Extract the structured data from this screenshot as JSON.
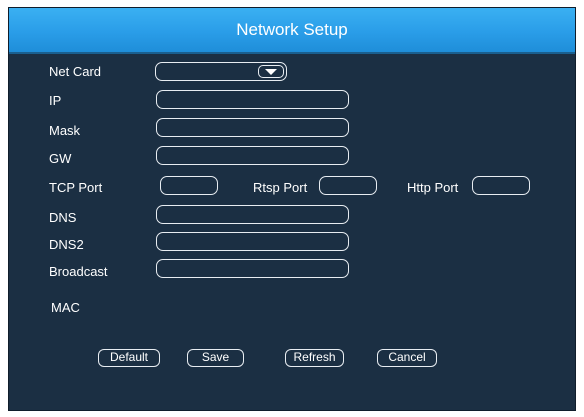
{
  "dialog": {
    "title": "Network Setup"
  },
  "form": {
    "net_card_label": "Net Card",
    "net_card_value": "",
    "ip_label": "IP",
    "ip_value": "",
    "mask_label": "Mask",
    "mask_value": "",
    "gw_label": "GW",
    "gw_value": "",
    "tcp_port_label": "TCP Port",
    "tcp_port_value": "",
    "rtsp_port_label": "Rtsp Port",
    "rtsp_port_value": "",
    "http_port_label": "Http Port",
    "http_port_value": "",
    "dns_label": "DNS",
    "dns_value": "",
    "dns2_label": "DNS2",
    "dns2_value": "",
    "broadcast_label": "Broadcast",
    "broadcast_value": "",
    "mac_label": "MAC",
    "mac_value": ""
  },
  "buttons": {
    "default": "Default",
    "save": "Save",
    "refresh": "Refresh",
    "cancel": "Cancel"
  },
  "colors": {
    "title_bar": "#2a9de8",
    "panel_background": "#1b2f43",
    "text": "#ffffff",
    "field_border": "#e8edf2"
  }
}
